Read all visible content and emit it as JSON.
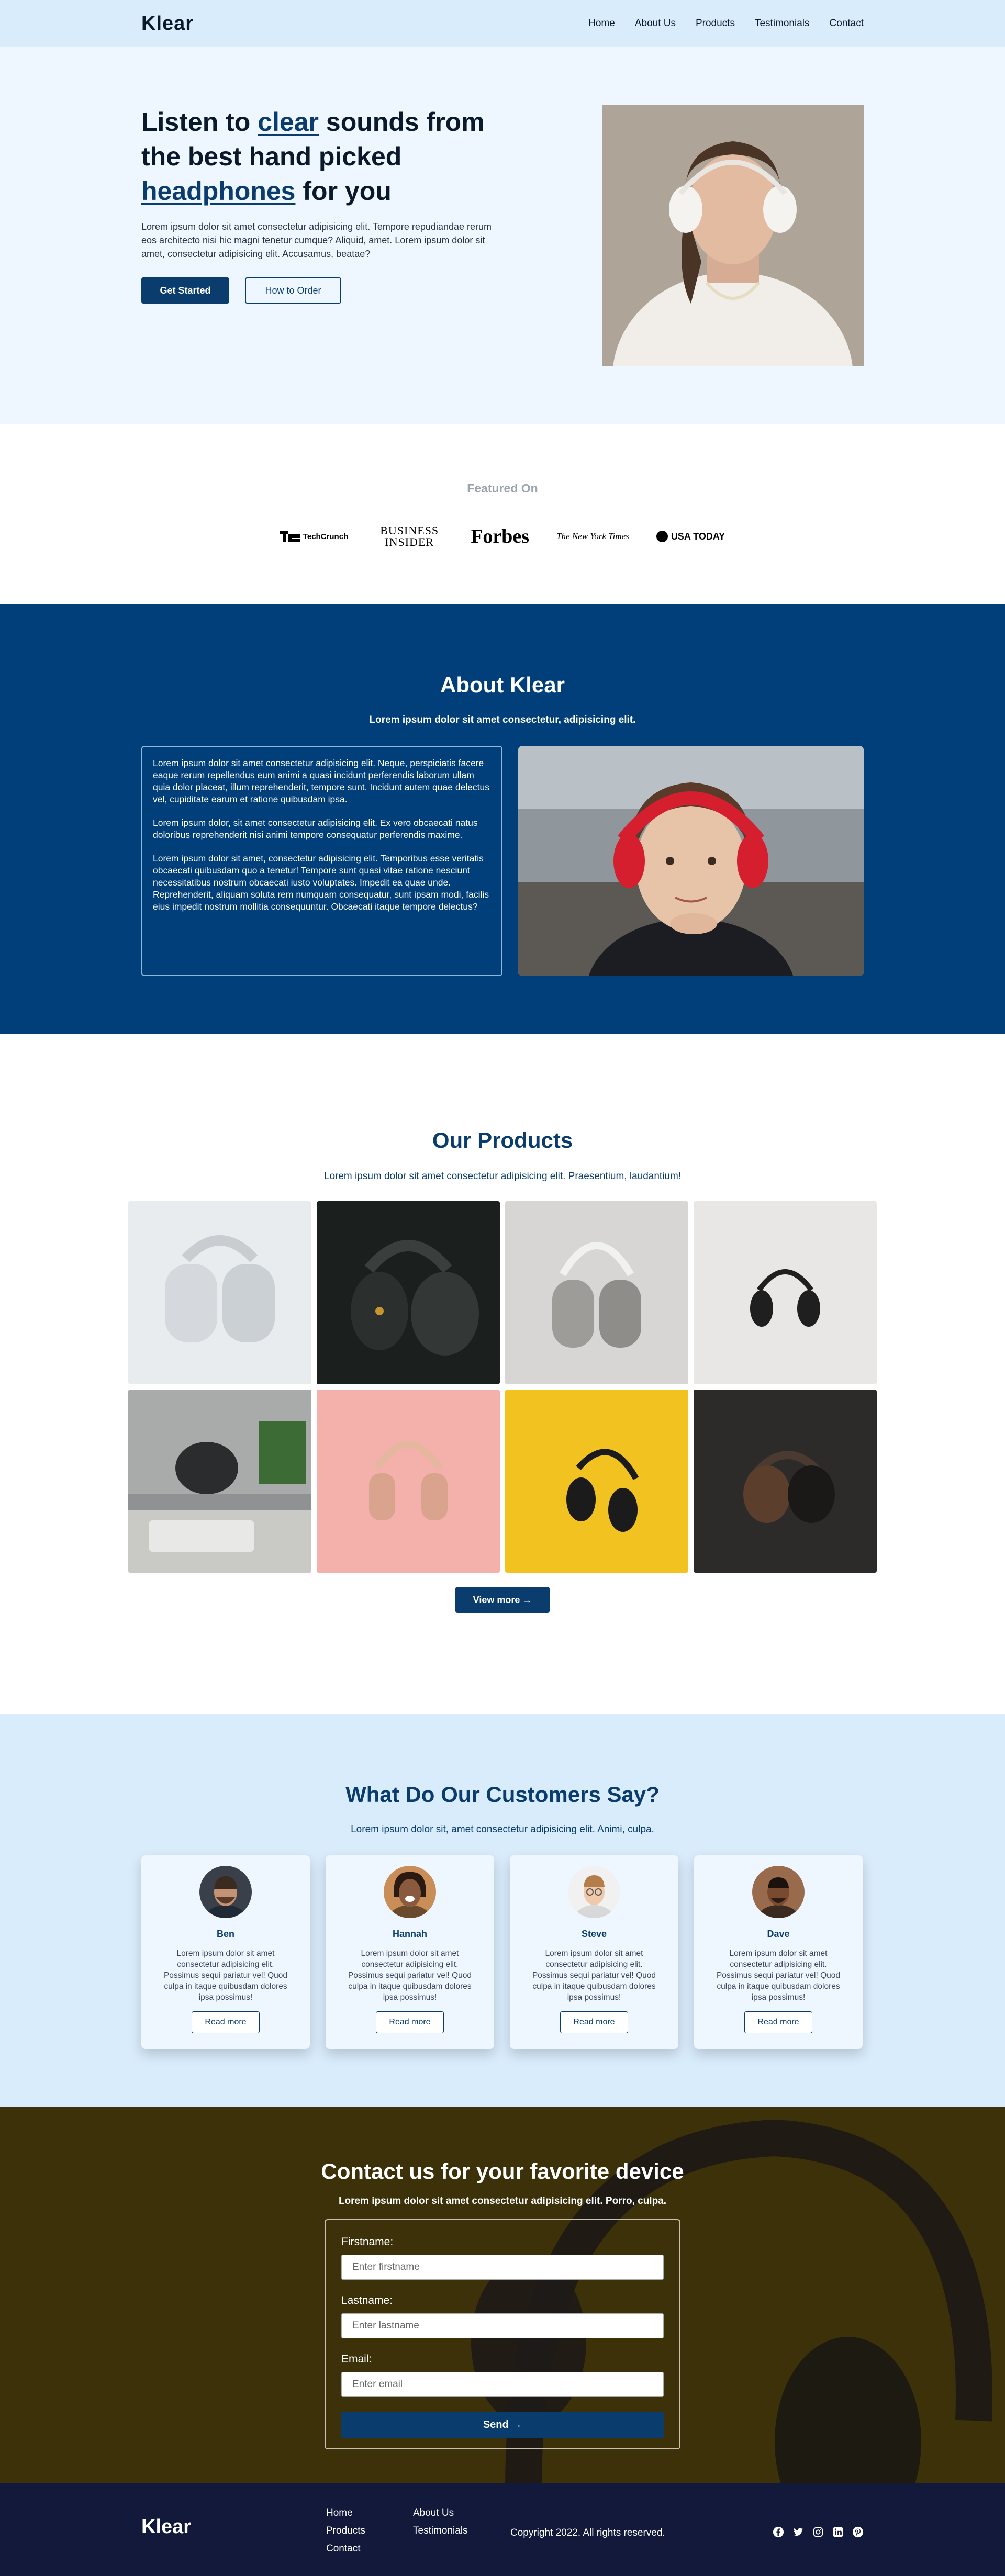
{
  "nav": {
    "logo": "Klear",
    "links": [
      "Home",
      "About Us",
      "Products",
      "Testimonials",
      "Contact"
    ]
  },
  "hero": {
    "title_part1": "Listen to ",
    "title_hl1": "clear",
    "title_part2": " sounds from the best hand picked ",
    "title_hl2": "headphones",
    "title_part3": " for you",
    "description": "Lorem ipsum dolor sit amet consectetur adipisicing elit. Tempore repudiandae rerum eos architecto nisi hic magni tenetur cumque? Aliquid, amet. Lorem ipsum dolor sit amet, consectetur adipisicing elit. Accusamus, beatae?",
    "primary_button": "Get Started",
    "secondary_button": "How to Order"
  },
  "featured": {
    "title": "Featured On",
    "logos": [
      "TechCrunch",
      "BUSINESS INSIDER",
      "Forbes",
      "The New York Times",
      "USA TODAY"
    ]
  },
  "about": {
    "title": "About Klear",
    "subtitle": "Lorem ipsum dolor sit amet consectetur, adipisicing elit.",
    "paragraphs": [
      "Lorem ipsum dolor sit amet consectetur adipisicing elit. Neque, perspiciatis facere eaque rerum repellendus eum animi a quasi incidunt perferendis laborum ullam quia dolor placeat, illum reprehenderit, tempore sunt. Incidunt autem quae delectus vel, cupiditate earum et ratione quibusdam ipsa.",
      "Lorem ipsum dolor, sit amet consectetur adipisicing elit. Ex vero obcaecati natus doloribus reprehenderit nisi animi tempore consequatur perferendis maxime.",
      "Lorem ipsum dolor sit amet, consectetur adipisicing elit. Temporibus esse veritatis obcaecati quibusdam quo a tenetur! Tempore sunt quasi vitae ratione nesciunt necessitatibus nostrum obcaecati iusto voluptates. Impedit ea quae unde. Reprehenderit, aliquam soluta rem numquam consequatur, sunt ipsam modi, facilis eius impedit nostrum mollitia consequuntur. Obcaecati itaque tempore delectus?"
    ]
  },
  "products": {
    "title": "Our Products",
    "subtitle": "Lorem ipsum dolor sit amet consectetur adipisicing elit. Praesentium, laudantium!",
    "view_more": "View more →"
  },
  "testimonials": {
    "title": "What Do Our Customers Say?",
    "subtitle": "Lorem ipsum dolor sit, amet consectetur adipisicing elit. Animi, culpa.",
    "cards": [
      {
        "name": "Ben",
        "text": "Lorem ipsum dolor sit amet consectetur adipisicing elit. Possimus sequi pariatur vel! Quod culpa in itaque quibusdam dolores ipsa possimus!",
        "button": "Read more"
      },
      {
        "name": "Hannah",
        "text": "Lorem ipsum dolor sit amet consectetur adipisicing elit. Possimus sequi pariatur vel! Quod culpa in itaque quibusdam dolores ipsa possimus!",
        "button": "Read more"
      },
      {
        "name": "Steve",
        "text": "Lorem ipsum dolor sit amet consectetur adipisicing elit. Possimus sequi pariatur vel! Quod culpa in itaque quibusdam dolores ipsa possimus!",
        "button": "Read more"
      },
      {
        "name": "Dave",
        "text": "Lorem ipsum dolor sit amet consectetur adipisicing elit. Possimus sequi pariatur vel! Quod culpa in itaque quibusdam dolores ipsa possimus!",
        "button": "Read more"
      }
    ]
  },
  "contact": {
    "title": "Contact us for your favorite device",
    "subtitle": "Lorem ipsum dolor sit amet consectetur adipisicing elit. Porro, culpa.",
    "firstname_label": "Firstname:",
    "firstname_placeholder": "Enter firstname",
    "lastname_label": "Lastname:",
    "lastname_placeholder": "Enter lastname",
    "email_label": "Email:",
    "email_placeholder": "Enter email",
    "send_button": "Send →"
  },
  "footer": {
    "logo": "Klear",
    "col1": [
      "Home",
      "Products",
      "Contact"
    ],
    "col2": [
      "About Us",
      "Testimonials"
    ],
    "copyright": "Copyright 2022. All rights reserved.",
    "social_icons": [
      "facebook-icon",
      "twitter-icon",
      "instagram-icon",
      "linkedin-icon",
      "pinterest-icon"
    ]
  },
  "colors": {
    "primary": "#0a3d6e",
    "nav_bg": "#d9ecfc",
    "hero_bg": "#eef7ff",
    "about_bg": "#003f7a",
    "footer_bg": "#12193b"
  }
}
